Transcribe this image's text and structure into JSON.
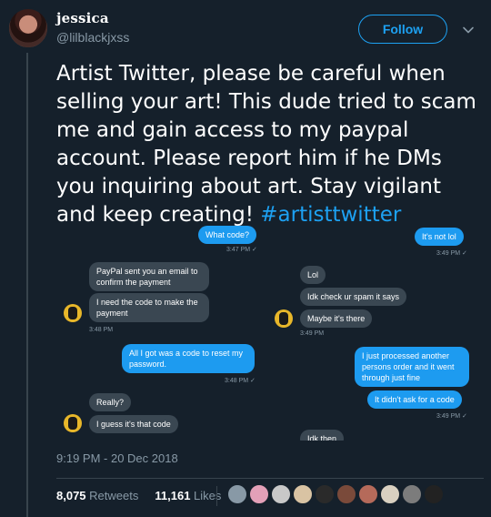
{
  "user": {
    "name": "jessica",
    "handle": "@lilblackjxss",
    "follow_label": "Follow"
  },
  "tweet": {
    "text": "Artist Twitter, please be careful when selling your art! This dude tried to scam me and gain access to my paypal account. Please report him if he DMs you inquiring about art. Stay vigilant and keep creating! ",
    "hashtag": "#artisttwitter",
    "timestamp": "9:19 PM - 20 Dec 2018"
  },
  "stats": {
    "retweets_count": "8,075",
    "retweets_label": "Retweets",
    "likes_count": "11,161",
    "likes_label": "Likes"
  },
  "media": {
    "left": {
      "msg1": "What code?",
      "ts1": "3:47 PM ✓",
      "msg2": "PayPal sent you an email to confirm the payment",
      "msg3": "I need the code to make the payment",
      "ts2": "3:48 PM",
      "msg4": "All I got was a code to reset my password.",
      "ts3": "3:48 PM ✓",
      "msg5": "Really?",
      "msg6": "I guess it's that code"
    },
    "right": {
      "msg1": "It's not lol",
      "ts1": "3:49 PM ✓",
      "msg2": "Lol",
      "msg3": "Idk check ur spam it says",
      "msg4": "Maybe it's there",
      "ts2": "3:49 PM",
      "msg5": "I just processed another persons order and it went through just fine",
      "msg6": "It didn't ask for a code",
      "ts3": "3:49 PM ✓",
      "msg7": "Idk then"
    }
  },
  "likers_colors": [
    "#8899a6",
    "#e3a0b8",
    "#c8c8c8",
    "#d9c3a3",
    "#2a2a2a",
    "#7a4a3a",
    "#b56a5a",
    "#d9d0c0",
    "#7c7c7c",
    "#222222"
  ]
}
